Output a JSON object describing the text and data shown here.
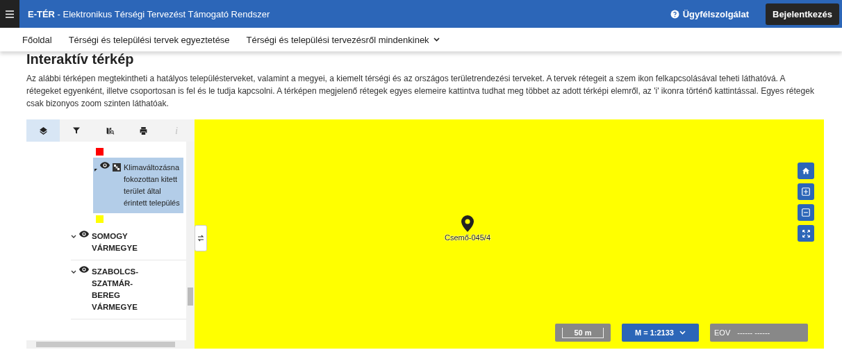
{
  "header": {
    "brand": "E-TÉR",
    "title": " - Elektronikus Térségi Tervezést Támogató Rendszer",
    "help": "Ügyfélszolgálat",
    "login": "Bejelentkezés"
  },
  "nav": [
    {
      "label": "Főoldal",
      "dropdown": false
    },
    {
      "label": "Térségi és települési tervek egyeztetése",
      "dropdown": false
    },
    {
      "label": "Térségi és települési tervezésről mindenkinek",
      "dropdown": true
    }
  ],
  "page_title": "Interaktív térkép",
  "intro": "Az alábbi térképen megtekintheti a hatályos településterveket, valamint a megyei, a kiemelt térségi és az országos területrendezési terveket. A tervek rétegeit a szem ikon felkapcsolásával teheti láthatóvá. A rétegeket egyenként, illetve csoportosan is fel és le tudja kapcsolni. A térképen megjelenő rétegek egyes elemeire kattintva tudhat meg többet az adott térképi elemről, az 'i' ikonra történő kattintással. Egyes rétegek csak bizonyos zoom szinten láthatóak.",
  "panel_tabs": [
    {
      "kind": "layers",
      "selected": true,
      "disabled": false
    },
    {
      "kind": "filter",
      "selected": false,
      "disabled": false
    },
    {
      "kind": "map-search",
      "selected": false,
      "disabled": false
    },
    {
      "kind": "print",
      "selected": false,
      "disabled": false
    },
    {
      "kind": "info",
      "label": "i",
      "selected": false,
      "disabled": true
    }
  ],
  "tree": [
    {
      "kind": "swatch",
      "color": "#ff0000"
    },
    {
      "kind": "layer",
      "label": "Klimaváltozásna fokozottan kitett terület által érintett település",
      "selected": true,
      "visible": true
    },
    {
      "kind": "swatch",
      "color": "#ffff00"
    },
    {
      "kind": "group",
      "label": "SOMOGY VÁRMEGYE",
      "visible": true
    },
    {
      "kind": "group",
      "label": "SZABOLCS-SZATMÁR-BEREG VÁRMEGYE",
      "visible": true
    }
  ],
  "map": {
    "marker_label": "Csemő-045/4",
    "controls": [
      {
        "kind": "home"
      },
      {
        "kind": "zoom-in"
      },
      {
        "kind": "zoom-out"
      },
      {
        "kind": "fullscreen"
      }
    ],
    "scale": "50 m",
    "scale_select": "M = 1:2133",
    "coord_system": "EOV",
    "coords": "------ ------"
  }
}
